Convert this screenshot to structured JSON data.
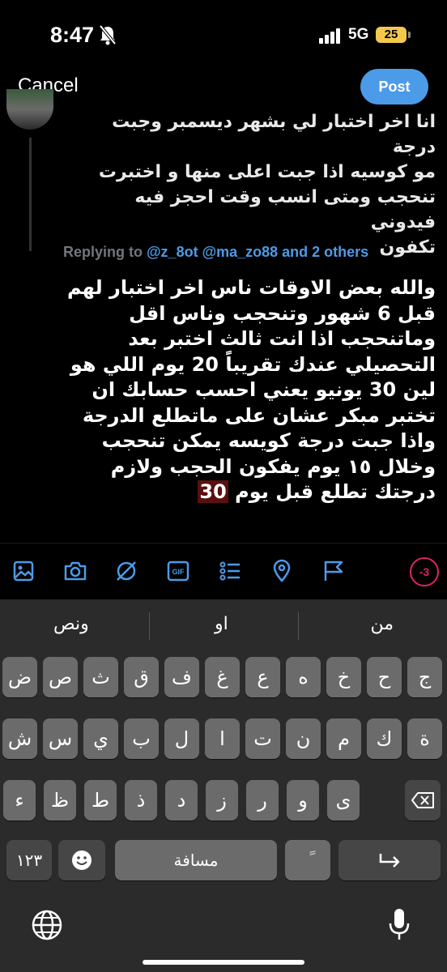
{
  "status": {
    "time": "8:47",
    "network": "5G",
    "battery": "25"
  },
  "header": {
    "cancel_label": "Cancel",
    "post_label": "Post"
  },
  "quoted_tweet": {
    "lines": [
      "انا اخر اختبار لي بشهر ديسمبر وجبت درجة",
      "مو كوسيه اذا جبت اعلى منها و اختبرت",
      "تنحجب ومتى انسب وقت احجز فيه فيدوني",
      "تكفون"
    ]
  },
  "replying": {
    "prefix": "Replying to ",
    "mentions": "@z_8ot @ma_zo88 and 2 others"
  },
  "composer": {
    "lines": [
      "والله بعض الاوقات ناس اخر اختبار لهم",
      "قبل 6 شهور وتنحجب وناس اقل",
      "وماتنحجب اذا انت ثالث اختبر بعد",
      "التحصيلي عندك تقريباً 20 يوم اللي هو",
      "لين 30 يونيو يعني احسب حسابك ان",
      "تختبر مبكر عشان على ماتطلع الدرجة",
      "واذا جبت درجة كويسه يمكن تنحجب",
      "وخلال ١٥ يوم يفكون الحجب ولازم"
    ],
    "last_line_text": "درجتك تطلع قبل يوم ",
    "last_line_highlight": "30"
  },
  "toolbar": {
    "icons": [
      "image-icon",
      "camera-icon",
      "no-sign-icon",
      "gif-icon",
      "list-icon",
      "location-icon",
      "flag-icon"
    ],
    "gif_label": "GIF",
    "counter": "-3"
  },
  "keyboard": {
    "suggestions": [
      "من",
      "او",
      "ونص"
    ],
    "row1": [
      "ج",
      "ح",
      "خ",
      "ه",
      "ع",
      "غ",
      "ف",
      "ق",
      "ث",
      "ص",
      "ض"
    ],
    "row2": [
      "ة",
      "ك",
      "م",
      "ن",
      "ت",
      "ا",
      "ل",
      "ب",
      "ي",
      "س",
      "ش"
    ],
    "row3": [
      "ى",
      "و",
      "ر",
      "ز",
      "د",
      "ذ",
      "ط",
      "ظ",
      "ء"
    ],
    "numbers_label": "١٢٣",
    "space_label": "مسافة",
    "diacritic_label": "ً"
  }
}
